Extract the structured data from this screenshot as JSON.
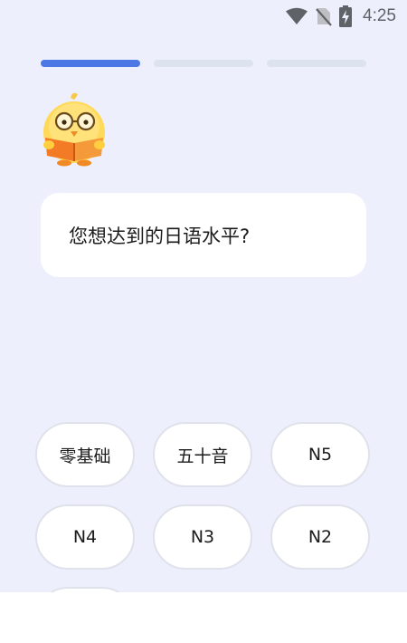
{
  "status_bar": {
    "time": "4:25",
    "icons": [
      "wifi-icon",
      "no-sim-icon",
      "battery-charging-icon"
    ]
  },
  "progress": {
    "total_steps": 3,
    "current_step": 1
  },
  "mascot": {
    "icon": "chick-reading-book-mascot"
  },
  "question": {
    "text": "您想达到的日语水平?"
  },
  "options": [
    {
      "label": "零基础"
    },
    {
      "label": "五十音"
    },
    {
      "label": "N5"
    },
    {
      "label": "N4"
    },
    {
      "label": "N3"
    },
    {
      "label": "N2"
    },
    {
      "label": ""
    }
  ],
  "colors": {
    "background": "#edf0fc",
    "accent": "#4e77e6",
    "progress_inactive": "#dde2ef",
    "card": "#ffffff"
  }
}
